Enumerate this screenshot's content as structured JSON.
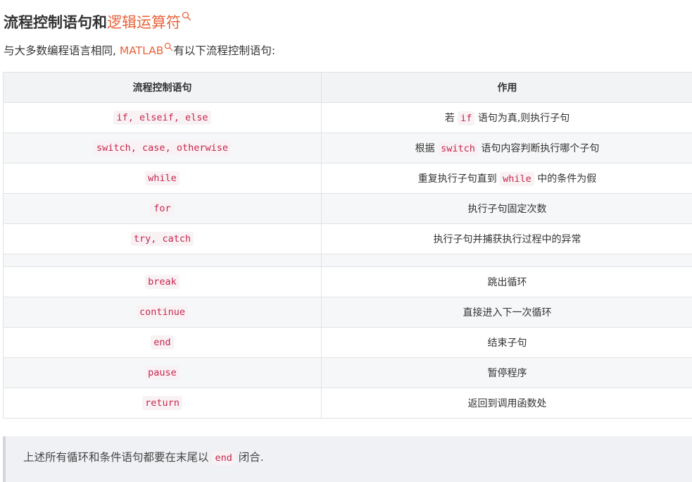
{
  "heading": {
    "text": "流程控制语句和",
    "link": "逻辑运算符"
  },
  "intro": {
    "before": "与大多数编程语言相同, ",
    "link": "MATLAB",
    "after": "有以下流程控制语句:"
  },
  "table": {
    "headers": [
      "流程控制语句",
      "作用"
    ],
    "rows": [
      {
        "stmt": "if, elseif, else",
        "pre": "若 ",
        "code": "if",
        "post": " 语句为真,则执行子句"
      },
      {
        "stmt": "switch, case, otherwise",
        "pre": "根据 ",
        "code": "switch",
        "post": " 语句内容判断执行哪个子句"
      },
      {
        "stmt": "while",
        "pre": "重复执行子句直到 ",
        "code": "while",
        "post": " 中的条件为假"
      },
      {
        "stmt": "for",
        "pre": "执行子句固定次数",
        "code": "",
        "post": ""
      },
      {
        "stmt": "try, catch",
        "pre": "执行子句并捕获执行过程中的异常",
        "code": "",
        "post": ""
      },
      {
        "stmt": "",
        "pre": "",
        "code": "",
        "post": ""
      },
      {
        "stmt": "break",
        "pre": "跳出循环",
        "code": "",
        "post": ""
      },
      {
        "stmt": "continue",
        "pre": "直接进入下一次循环",
        "code": "",
        "post": ""
      },
      {
        "stmt": "end",
        "pre": "结束子句",
        "code": "",
        "post": ""
      },
      {
        "stmt": "pause",
        "pre": "暂停程序",
        "code": "",
        "post": ""
      },
      {
        "stmt": "return",
        "pre": "返回到调用函数处",
        "code": "",
        "post": ""
      }
    ]
  },
  "note": {
    "before": "上述所有循环和条件语句都要在末尾以 ",
    "code": "end",
    "after": " 闭合."
  },
  "colors": {
    "link": "#e8623a",
    "code_text": "#c7254e",
    "code_bg": "#f9f2f4",
    "header_bg": "#f2f3f5",
    "note_bg": "#f0f1f4"
  },
  "icons": [
    "search-icon"
  ]
}
